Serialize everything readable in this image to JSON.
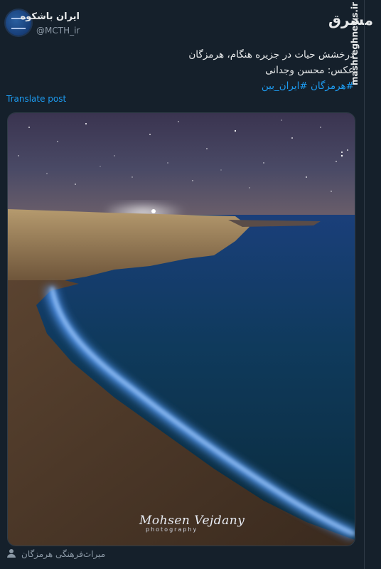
{
  "tweet": {
    "display_name": "ایران باشکوه",
    "handle": "@MCTH_ir",
    "lines": [
      "درخشش حیات در جزیره هنگام، هرمزگان",
      "عکس: محسن وجدانی"
    ],
    "hashtags": "#هرمزگان #ایران_بین",
    "translate_label": "Translate post"
  },
  "watermark": {
    "logo": "مشرق",
    "site": "mashreghnews.ir"
  },
  "media": {
    "signature": "Mohsen Vejdany",
    "signature_sub": "photography"
  },
  "footer": {
    "attribution": "میراث‌فرهنگی هرمزگان"
  },
  "colors": {
    "background": "#15202b",
    "link": "#1d9bf0",
    "bioluminescence": "#2f7dff"
  }
}
